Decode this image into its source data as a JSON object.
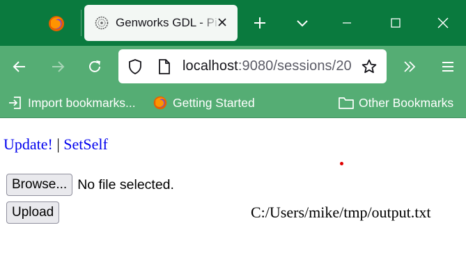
{
  "browser": {
    "tab": {
      "title": "Genworks GDL - Pi"
    },
    "url": {
      "host": "localhost",
      "rest": ":9080/sessions/20"
    },
    "bookmarks": {
      "import_label": "Import bookmarks...",
      "getting_started_label": "Getting Started",
      "other_label": "Other Bookmarks"
    },
    "icons": {
      "firefox": "firefox-logo-icon",
      "favicon": "genworks-favicon-icon",
      "close_tab": "close-icon",
      "new_tab": "plus-icon",
      "tab_list": "chevron-down-icon",
      "minimize": "minimize-icon",
      "maximize": "maximize-icon",
      "close_window": "close-icon",
      "back": "back-arrow-icon",
      "forward": "forward-arrow-icon",
      "reload": "reload-icon",
      "tracking": "shield-icon",
      "page_info": "page-icon",
      "bookmark_star": "star-icon",
      "overflow": "double-chevron-right-icon",
      "menu": "hamburger-menu-icon",
      "import": "import-icon",
      "folder": "folder-icon"
    }
  },
  "page": {
    "links": {
      "update_label": "Update!",
      "separator": "|",
      "setself_label": "SetSelf"
    },
    "file_input": {
      "browse_label": "Browse...",
      "status": "No file selected."
    },
    "upload_label": "Upload",
    "output_path": "C:/Users/mike/tmp/output.txt"
  }
}
